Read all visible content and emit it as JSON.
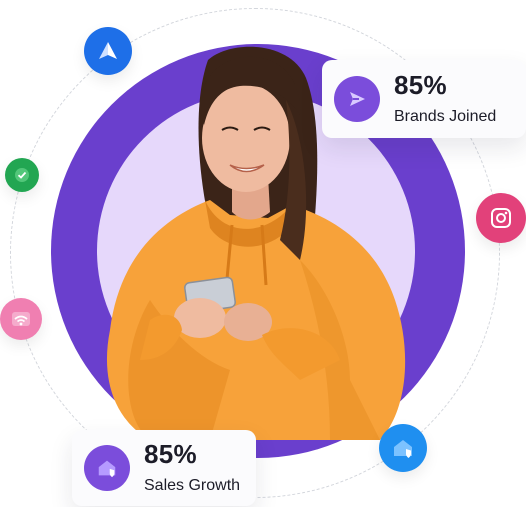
{
  "cards": {
    "brands": {
      "value": "85%",
      "label": "Brands Joined"
    },
    "sales": {
      "value": "85%",
      "label": "Sales Growth"
    }
  },
  "colors": {
    "ring": "#6a3fcd",
    "inner_circle": "#e6d8fb",
    "hoodie": "#f7a23a",
    "card_icon": "#7b4ddb"
  },
  "icons": [
    "triangle-logo-icon",
    "check-badge-icon",
    "wifi-icon",
    "instagram-icon",
    "home-shield-icon",
    "send-icon"
  ]
}
